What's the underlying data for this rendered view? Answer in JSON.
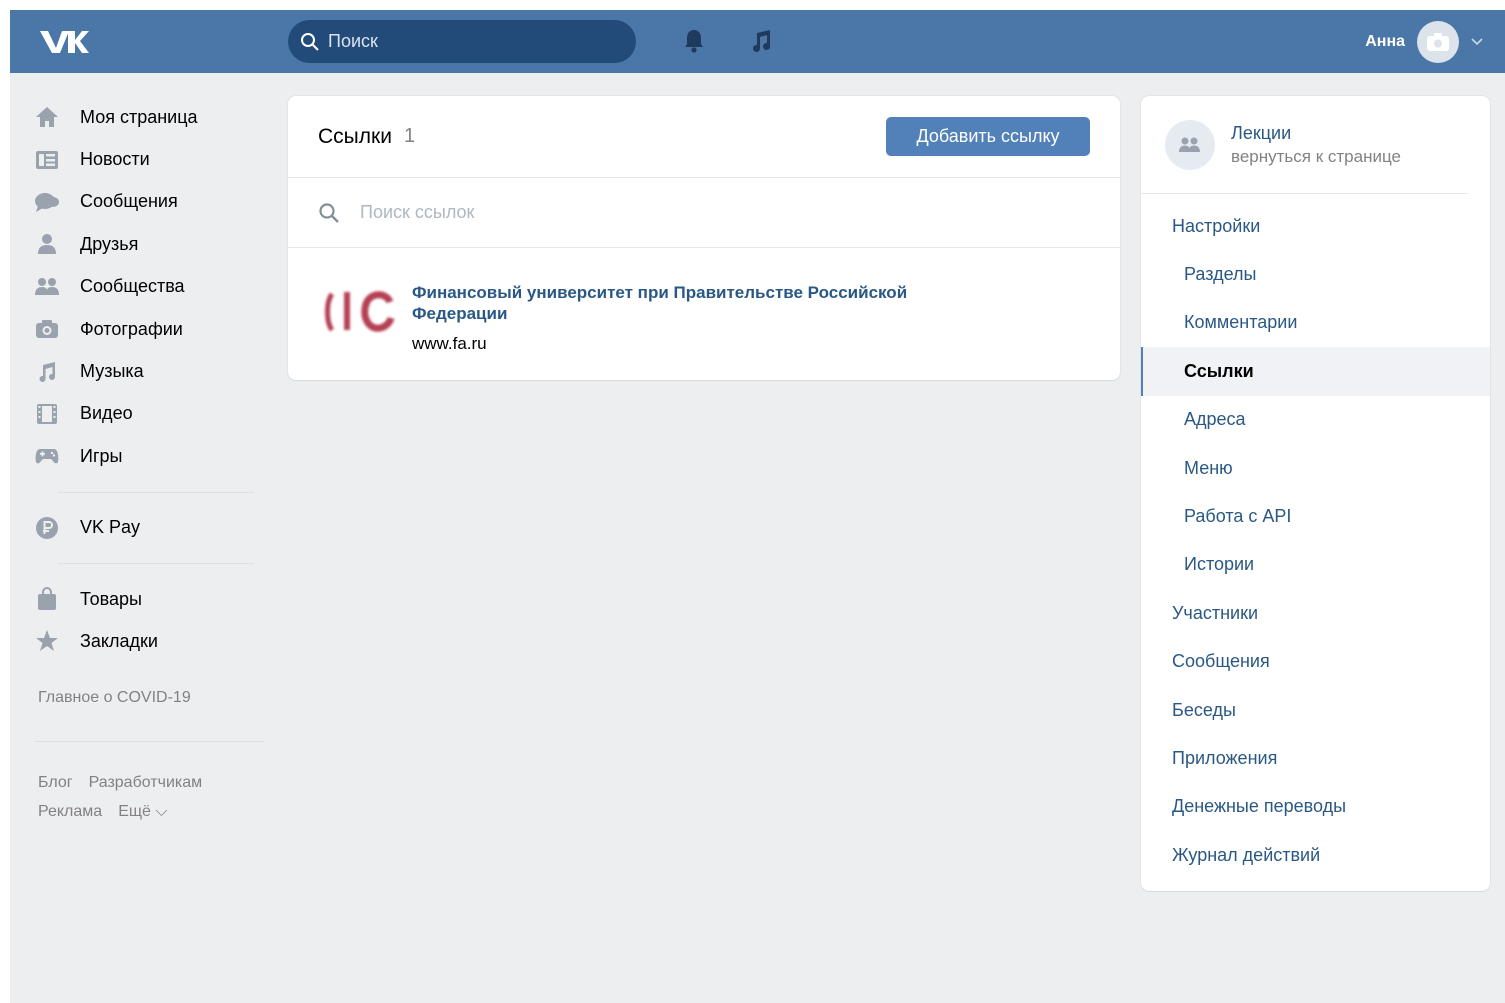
{
  "header": {
    "logo_text": "VK",
    "search_placeholder": "Поиск",
    "user_name": "Анна"
  },
  "leftnav": {
    "items": [
      {
        "label": "Моя страница",
        "icon": "home-icon"
      },
      {
        "label": "Новости",
        "icon": "news-icon"
      },
      {
        "label": "Сообщения",
        "icon": "messages-icon"
      },
      {
        "label": "Друзья",
        "icon": "friends-icon"
      },
      {
        "label": "Сообщества",
        "icon": "communities-icon"
      },
      {
        "label": "Фотографии",
        "icon": "camera-icon"
      },
      {
        "label": "Музыка",
        "icon": "music-icon"
      },
      {
        "label": "Видео",
        "icon": "video-icon"
      },
      {
        "label": "Игры",
        "icon": "gamepad-icon"
      }
    ],
    "vkpay": {
      "label": "VK Pay",
      "icon": "vkpay-icon"
    },
    "extra": [
      {
        "label": "Товары",
        "icon": "bag-icon"
      },
      {
        "label": "Закладки",
        "icon": "star-icon"
      }
    ],
    "covid": "Главное о COVID-19",
    "footer": {
      "blog": "Блог",
      "developers": "Разработчикам",
      "ads": "Реклама",
      "more": "Ещё ⌵"
    }
  },
  "main": {
    "title": "Ссылки",
    "count": "1",
    "add_button": "Добавить ссылку",
    "search_placeholder": "Поиск ссылок",
    "links": [
      {
        "title": "Финансовый университет при Правительстве Российской Федерации",
        "url": "www.fa.ru"
      }
    ]
  },
  "rightmenu": {
    "group_name": "Лекции",
    "group_back": "вернуться к странице",
    "items": [
      {
        "label": "Настройки",
        "sub": false,
        "active": false
      },
      {
        "label": "Разделы",
        "sub": true,
        "active": false
      },
      {
        "label": "Комментарии",
        "sub": true,
        "active": false
      },
      {
        "label": "Ссылки",
        "sub": true,
        "active": true
      },
      {
        "label": "Адреса",
        "sub": true,
        "active": false
      },
      {
        "label": "Меню",
        "sub": true,
        "active": false
      },
      {
        "label": "Работа с API",
        "sub": true,
        "active": false
      },
      {
        "label": "Истории",
        "sub": true,
        "active": false
      },
      {
        "label": "Участники",
        "sub": false,
        "active": false
      },
      {
        "label": "Сообщения",
        "sub": false,
        "active": false
      },
      {
        "label": "Беседы",
        "sub": false,
        "active": false
      },
      {
        "label": "Приложения",
        "sub": false,
        "active": false
      },
      {
        "label": "Денежные переводы",
        "sub": false,
        "active": false
      },
      {
        "label": "Журнал действий",
        "sub": false,
        "active": false
      }
    ]
  },
  "colors": {
    "header_bg": "#4a76a8",
    "search_bg": "#224b7a",
    "page_bg": "#edeef0",
    "accent": "#5181b8",
    "link": "#2a5885",
    "icon_gray": "#99a2ad"
  }
}
